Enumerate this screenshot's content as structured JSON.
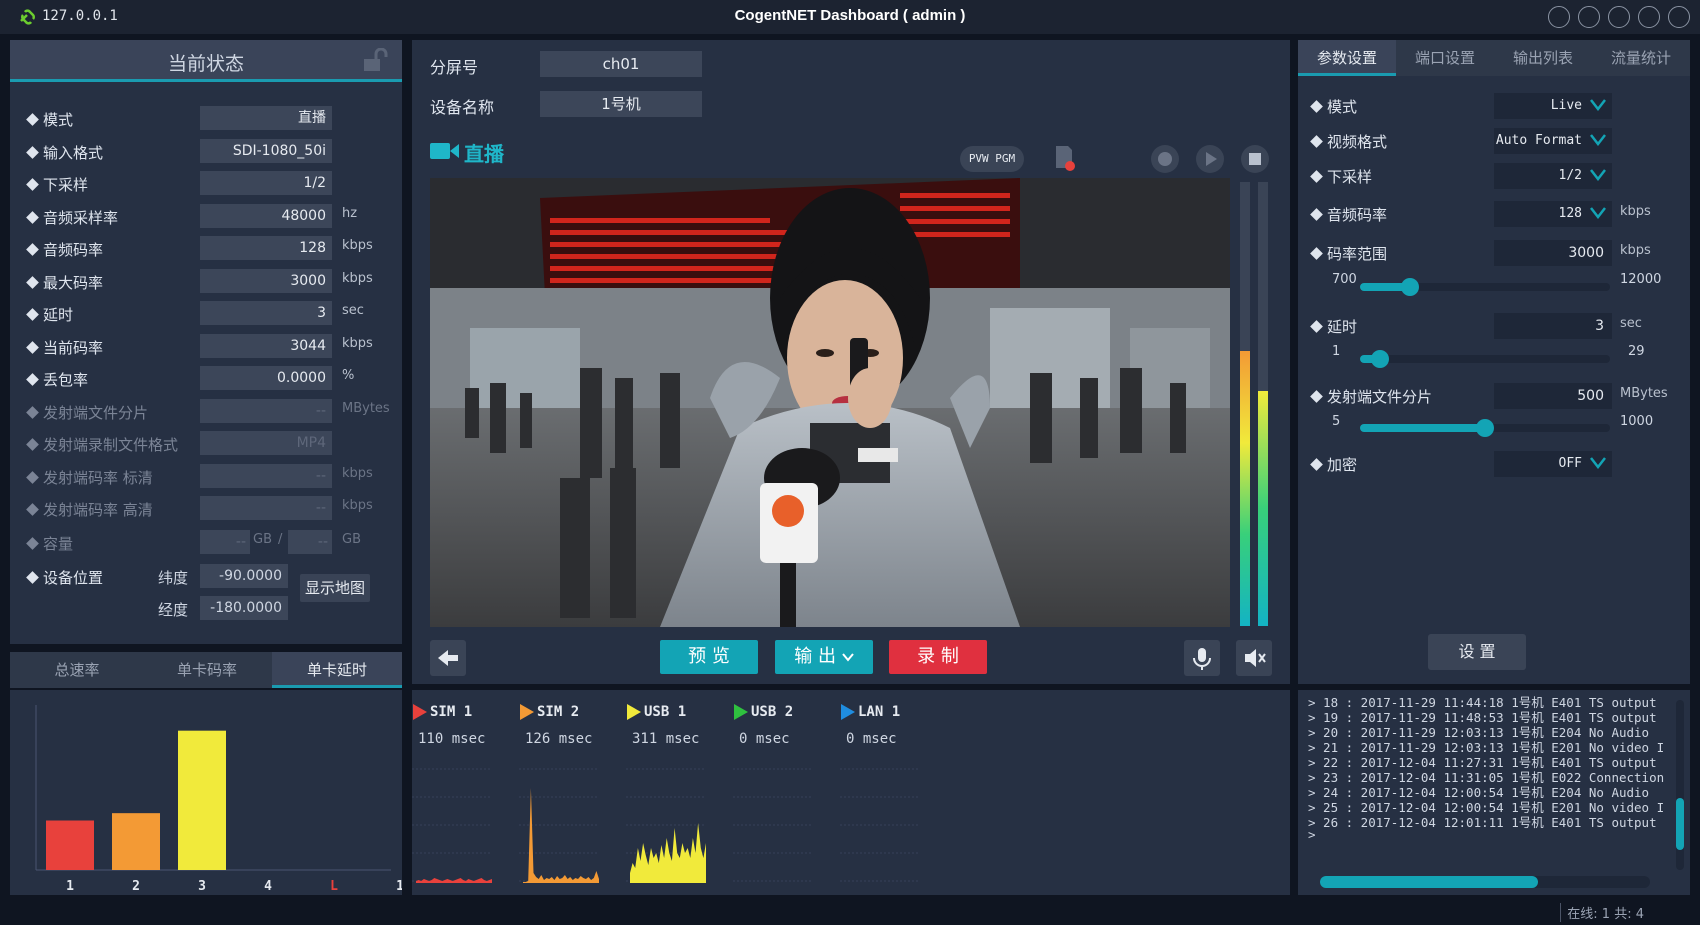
{
  "titlebar": {
    "host": "127.0.0.1",
    "title": "CogentNET Dashboard ( admin )"
  },
  "left": {
    "header": "当前状态",
    "rows": [
      {
        "label": "模式",
        "value": "直播",
        "unit": ""
      },
      {
        "label": "输入格式",
        "value": "SDI-1080_50i",
        "unit": ""
      },
      {
        "label": "下采样",
        "value": "1/2",
        "unit": ""
      },
      {
        "label": "音频采样率",
        "value": "48000",
        "unit": "hz"
      },
      {
        "label": "音频码率",
        "value": "128",
        "unit": "kbps"
      },
      {
        "label": "最大码率",
        "value": "3000",
        "unit": "kbps"
      },
      {
        "label": "延时",
        "value": "3",
        "unit": "sec"
      },
      {
        "label": "当前码率",
        "value": "3044",
        "unit": "kbps"
      },
      {
        "label": "丢包率",
        "value": "0.0000",
        "unit": "%"
      },
      {
        "label": "发射端文件分片",
        "value": "--",
        "unit": "MBytes"
      },
      {
        "label": "发射端录制文件格式",
        "value": "MP4",
        "unit": ""
      },
      {
        "label": "发射端码率   标清",
        "value": "--",
        "unit": "kbps"
      },
      {
        "label": "发射端码率   高清",
        "value": "--",
        "unit": "kbps"
      }
    ],
    "capacity": {
      "label": "容量",
      "used": "--",
      "unit1": "GB",
      "sep": "/",
      "total": "--",
      "unit2": "GB"
    },
    "location": {
      "label": "设备位置",
      "lat_label": "纬度",
      "lat": "-90.0000",
      "lon_label": "经度",
      "lon": "-180.0000",
      "map_button": "显示地图"
    },
    "tabs": [
      "总速率",
      "单卡码率",
      "单卡延时"
    ],
    "active_tab": 2
  },
  "lb_chart": {
    "chart_data": {
      "type": "bar",
      "categories": [
        "1",
        "2",
        "3",
        "4",
        "L",
        "1"
      ],
      "values": [
        27,
        31,
        76,
        0,
        0,
        0
      ],
      "colors": [
        "#e8413c",
        "#f39a35",
        "#f1ea3b",
        "#f1ea3b",
        "#e8413c",
        "#1f8de0"
      ],
      "ylim": [
        0,
        90
      ]
    }
  },
  "middle": {
    "screen_label": "分屏号",
    "screen_value": "ch01",
    "device_label": "设备名称",
    "device_value": "1号机",
    "live_title": "直播",
    "pvw_pgm": "PVW PGM",
    "buttons": {
      "preview": "预 览",
      "output": "输 出",
      "record": "录 制"
    },
    "vu_levels": [
      0.62,
      0.53
    ],
    "sims": [
      {
        "name": "SIM 1",
        "latency": "110 msec",
        "color": "#e8413c"
      },
      {
        "name": "SIM 2",
        "latency": "126 msec",
        "color": "#f39a35"
      },
      {
        "name": "USB 1",
        "latency": "311 msec",
        "color": "#f1ea3b"
      },
      {
        "name": "USB 2",
        "latency": "0 msec",
        "color": "#2fc13f"
      },
      {
        "name": "LAN 1",
        "latency": "0 msec",
        "color": "#1f8de0"
      }
    ]
  },
  "right": {
    "tabs": [
      "参数设置",
      "端口设置",
      "输出列表",
      "流量统计"
    ],
    "active_tab": 0,
    "mode": {
      "label": "模式",
      "value": "Live"
    },
    "video_format": {
      "label": "视频格式",
      "value": "Auto Format"
    },
    "downsample": {
      "label": "下采样",
      "value": "1/2"
    },
    "audio_rate": {
      "label": "音频码率",
      "value": "128",
      "unit": "kbps"
    },
    "bitrate_range": {
      "label": "码率范围",
      "value": "3000",
      "unit": "kbps",
      "min": "700",
      "max": "12000",
      "level": 0.2
    },
    "delay": {
      "label": "延时",
      "value": "3",
      "unit": "sec",
      "min": "1",
      "max": "29",
      "level": 0.08
    },
    "split": {
      "label": "发射端文件分片",
      "value": "500",
      "unit": "MBytes",
      "min": "5",
      "max": "1000",
      "level": 0.5
    },
    "encrypt": {
      "label": "加密",
      "value": "OFF"
    },
    "set_button": "设 置"
  },
  "log": {
    "lines": [
      "> 18 : 2017-11-29 11:44:18 1号机 E401 TS output",
      "> 19 : 2017-11-29 11:48:53 1号机 E401 TS output",
      "> 20 : 2017-11-29 12:03:13 1号机 E204 No Audio",
      "> 21 : 2017-11-29 12:03:13 1号机 E201 No video I",
      "> 22 : 2017-12-04 11:27:31 1号机 E401 TS output",
      "> 23 : 2017-12-04 11:31:05 1号机 E022 Connection",
      "> 24 : 2017-12-04 12:00:54 1号机 E204 No Audio",
      "> 25 : 2017-12-04 12:00:54 1号机 E201 No video I",
      "> 26 : 2017-12-04 12:01:11 1号机 E401 TS output",
      ">"
    ]
  },
  "status": {
    "text": "在线: 1 共: 4"
  }
}
